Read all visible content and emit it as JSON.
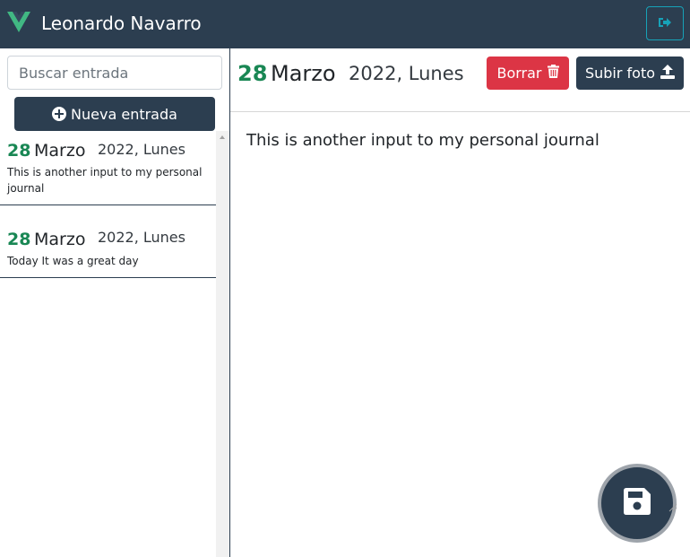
{
  "navbar": {
    "user_name": "Leonardo Navarro",
    "logo_icon": "vue-logo-icon",
    "logout_icon": "sign-out-icon",
    "colors": {
      "background": "#2c3e50",
      "logo_green": "#41b883",
      "logo_dark": "#35495e",
      "logout_border": "#17a2b8"
    }
  },
  "sidebar": {
    "search": {
      "placeholder": "Buscar entrada",
      "value": ""
    },
    "new_entry_label": "Nueva entrada",
    "new_entry_icon": "plus-circle-icon",
    "entries": [
      {
        "day": "28",
        "month": "Marzo",
        "year_weekday": "2022, Lunes",
        "text": "This is another input to my personal journal"
      },
      {
        "day": "28",
        "month": "Marzo",
        "year_weekday": "2022, Lunes",
        "text": "Today It was a great day"
      }
    ]
  },
  "entry_view": {
    "day": "28",
    "month": "Marzo",
    "year_weekday": "2022, Lunes",
    "delete_label": "Borrar",
    "delete_icon": "trash-icon",
    "upload_label": "Subir foto",
    "upload_icon": "upload-icon",
    "content": "This is another input to my personal journal",
    "save_icon": "save-icon",
    "colors": {
      "day_green": "#198754",
      "danger": "#dc3545",
      "primary": "#2c3e50"
    }
  }
}
